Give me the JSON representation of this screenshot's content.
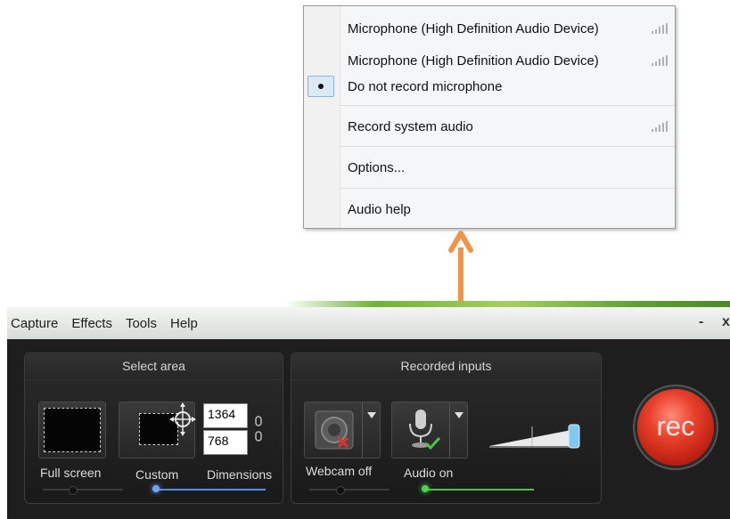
{
  "audio_menu": {
    "items": [
      {
        "label": "Microphone (High Definition Audio Device)",
        "signal": true
      },
      {
        "label": "Microphone (High Definition Audio Device)",
        "signal": true
      },
      {
        "label": "Do not record microphone",
        "selected": true
      },
      {
        "label": "Record system audio",
        "signal": true
      },
      {
        "label": "Options..."
      },
      {
        "label": "Audio help"
      }
    ]
  },
  "annotation": {
    "arrow_color": "#f3934a",
    "icon": "arrow-up-icon"
  },
  "recorder": {
    "menubar": [
      "Capture",
      "Effects",
      "Tools",
      "Help"
    ],
    "window_controls": {
      "minimize": "-",
      "close": "x"
    },
    "select_area": {
      "title": "Select area",
      "full_screen_label": "Full screen",
      "custom_label": "Custom",
      "dimensions_label": "Dimensions",
      "width": "1364",
      "height": "768"
    },
    "recorded_inputs": {
      "title": "Recorded inputs",
      "webcam_label": "Webcam off",
      "audio_label": "Audio on"
    },
    "rec_button_label": "rec",
    "colors": {
      "rec": "#e8402a",
      "accent_blue": "#4f8ff0",
      "accent_green": "#4cc24c"
    }
  }
}
